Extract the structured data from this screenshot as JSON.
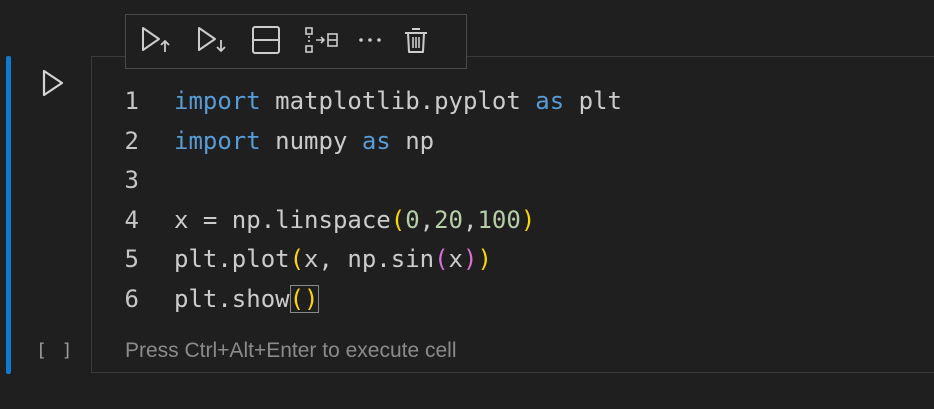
{
  "cell": {
    "execution_count": "[ ]",
    "status_hint": "Press Ctrl+Alt+Enter to execute cell",
    "focus_color": "#0e7ad1",
    "run_icon": "play-icon"
  },
  "toolbar": {
    "actions": [
      {
        "icon": "execute-above-icon",
        "name": "execute-above"
      },
      {
        "icon": "execute-below-icon",
        "name": "execute-below"
      },
      {
        "icon": "split-cell-icon",
        "name": "split-cell"
      },
      {
        "icon": "insert-cell-icon",
        "name": "insert-cell"
      },
      {
        "icon": "more-actions-icon",
        "name": "more-actions"
      },
      {
        "icon": "trash-icon",
        "name": "delete-cell"
      }
    ],
    "more_label": "···"
  },
  "code": {
    "line_numbers": [
      "1",
      "2",
      "3",
      "4",
      "5",
      "6"
    ],
    "tokens": {
      "l1_import": "import",
      "l1_module": " matplotlib.pyplot ",
      "l1_as": "as",
      "l1_alias": " plt",
      "l2_import": "import",
      "l2_module": " numpy ",
      "l2_as": "as",
      "l2_alias": " np",
      "l4_lhs": "x = np.linspace",
      "l4_open": "(",
      "l4_n0": "0",
      "l4_c1": ",",
      "l4_n1": "20",
      "l4_c2": ",",
      "l4_n2": "100",
      "l4_close": ")",
      "l5_fn": "plt.plot",
      "l5_open": "(",
      "l5_arg": "x, np.sin",
      "l5_open2": "(",
      "l5_x": "x",
      "l5_close2": ")",
      "l5_close": ")",
      "l6_fn": "plt.show",
      "l6_parens": "()"
    }
  },
  "colors": {
    "keyword": "#569cd6",
    "number": "#b5cea8",
    "bracket_level1": "#ffd700",
    "bracket_level2": "#da70d6",
    "text": "#cccccc"
  }
}
